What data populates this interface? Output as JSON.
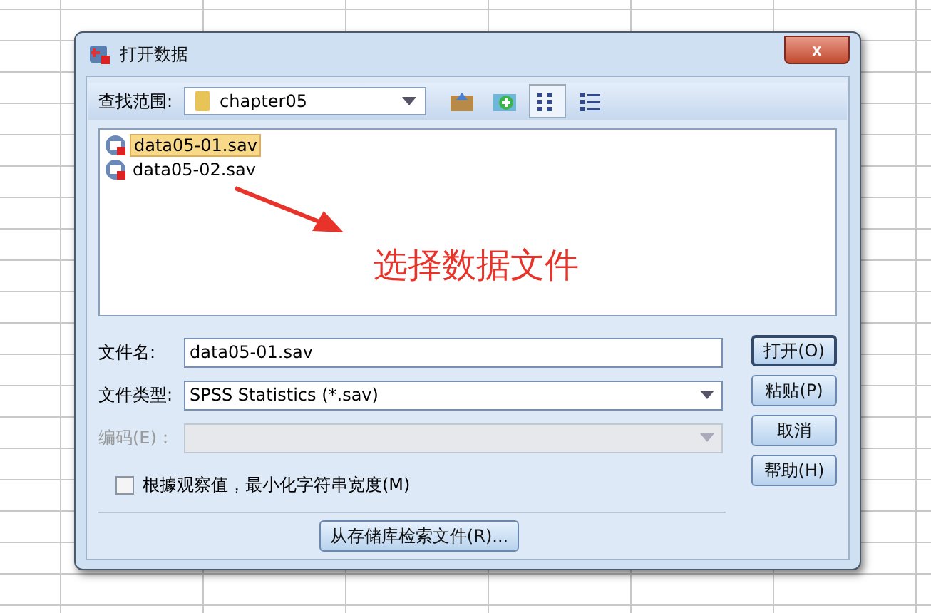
{
  "window": {
    "title": "打开数据",
    "close": "x"
  },
  "look_in": {
    "label": "查找范围:",
    "value": "chapter05"
  },
  "files": [
    {
      "name": "data05-01.sav",
      "selected": true
    },
    {
      "name": "data05-02.sav",
      "selected": false
    }
  ],
  "annotation": {
    "text": "选择数据文件"
  },
  "fields": [
    {
      "kind": "input",
      "label": "文件名:",
      "value": "data05-01.sav",
      "disabled": false
    },
    {
      "kind": "select",
      "label": "文件类型:",
      "value": "SPSS Statistics (*.sav)",
      "disabled": false
    },
    {
      "kind": "select",
      "label": "编码(E)：",
      "disabled": true
    }
  ],
  "checkbox": {
    "label": "根據观察值，最小化字符串宽度(M)",
    "checked": false
  },
  "buttons": [
    {
      "label": "打开(O)",
      "selected": true
    },
    {
      "label": "粘贴(P)",
      "selected": false
    },
    {
      "label": "取消",
      "selected": false
    },
    {
      "label": "帮助(H)",
      "selected": false
    }
  ],
  "repository_button": "从存储库检索文件(R)..."
}
